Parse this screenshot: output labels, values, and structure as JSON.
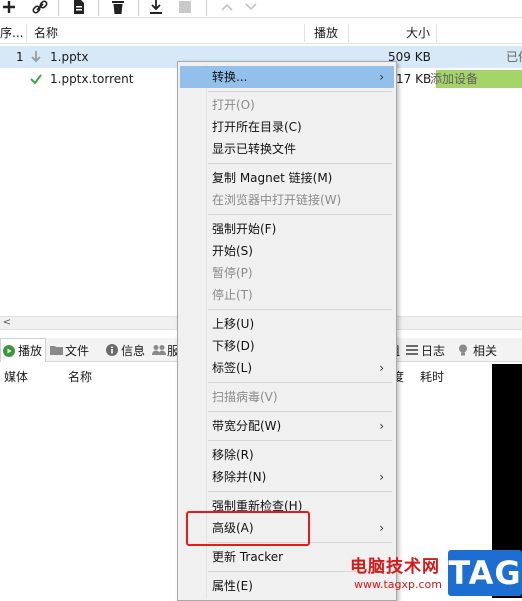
{
  "columns": {
    "seq": "序...",
    "name": "名称",
    "play": "播放",
    "size": "大小",
    "status": "已..."
  },
  "rows": [
    {
      "seq": "1",
      "name": "1.pptx",
      "size": "509 KB",
      "status": "已停"
    },
    {
      "seq": "",
      "name": "1.pptx.torrent",
      "size": "17 KB",
      "status": "添加设备"
    }
  ],
  "tabs": [
    {
      "label": "播放"
    },
    {
      "label": "文件"
    },
    {
      "label": "信息"
    },
    {
      "label": "服"
    },
    {
      "label": "组"
    },
    {
      "label": "日志"
    },
    {
      "label": "相关"
    }
  ],
  "detail_columns": {
    "media": "媒体",
    "name": "名称",
    "de": "度",
    "time": "耗时"
  },
  "menu": {
    "items": [
      {
        "label": "转换...",
        "state": "highlighted",
        "submenu": true
      },
      {
        "label": "打开(O)",
        "state": "disabled"
      },
      {
        "label": "打开所在目录(C)",
        "state": "enabled"
      },
      {
        "label": "显示已转换文件",
        "state": "enabled"
      },
      {
        "label": "复制 Magnet 链接(M)",
        "state": "enabled"
      },
      {
        "label": "在浏览器中打开链接(W)",
        "state": "disabled"
      },
      {
        "label": "强制开始(F)",
        "state": "enabled"
      },
      {
        "label": "开始(S)",
        "state": "enabled"
      },
      {
        "label": "暂停(P)",
        "state": "disabled"
      },
      {
        "label": "停止(T)",
        "state": "disabled"
      },
      {
        "label": "上移(U)",
        "state": "enabled"
      },
      {
        "label": "下移(D)",
        "state": "enabled"
      },
      {
        "label": "标签(L)",
        "state": "enabled",
        "submenu": true
      },
      {
        "label": "扫描病毒(V)",
        "state": "disabled"
      },
      {
        "label": "带宽分配(W)",
        "state": "enabled",
        "submenu": true
      },
      {
        "label": "移除(R)",
        "state": "enabled"
      },
      {
        "label": "移除并(N)",
        "state": "enabled",
        "submenu": true
      },
      {
        "label": "强制重新检查(H)",
        "state": "enabled"
      },
      {
        "label": "高级(A)",
        "state": "enabled",
        "submenu": true
      },
      {
        "label": "更新 Tracker",
        "state": "enabled"
      },
      {
        "label": "属性(E)",
        "state": "enabled"
      }
    ],
    "submenu_arrow": "›"
  },
  "scroll_left_glyph": "<",
  "watermark": {
    "title": "电脑技术网",
    "url": "www.tagxp.com",
    "badge": "TAG"
  },
  "colors": {
    "highlight": "#92c0ea",
    "selected_row": "#d7e8f7",
    "progress": "#a4d468",
    "red_box": "#e31b1b",
    "check": "#3aa83a"
  }
}
